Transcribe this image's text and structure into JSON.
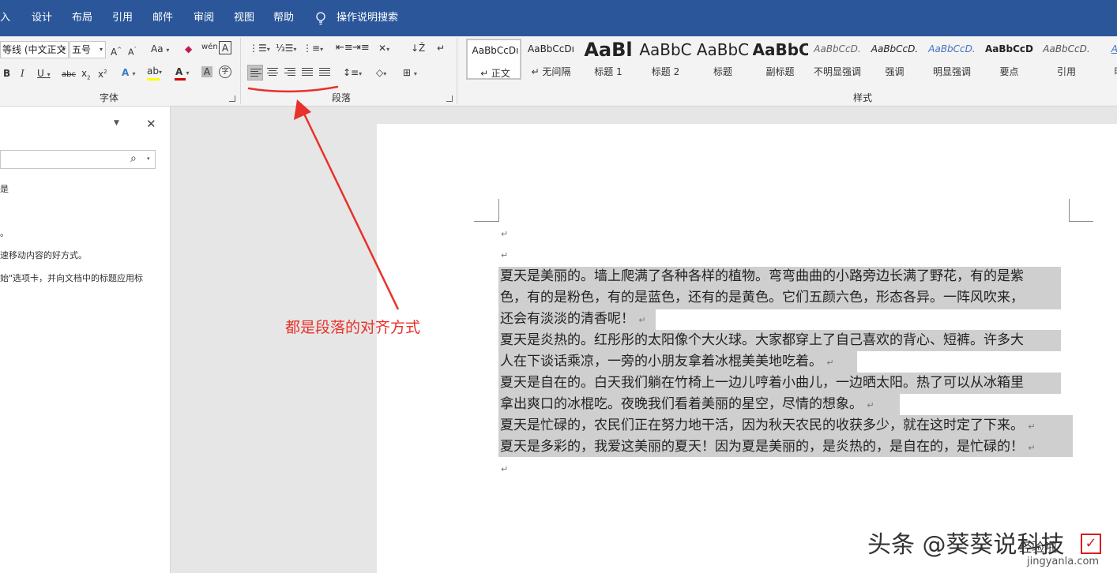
{
  "tabs": [
    "入",
    "设计",
    "布局",
    "引用",
    "邮件",
    "审阅",
    "视图",
    "帮助"
  ],
  "tell_me": "操作说明搜索",
  "font": {
    "family": "等线 (中文正文",
    "size": "五号",
    "group_label": "字体"
  },
  "paragraph": {
    "group_label": "段落"
  },
  "styles": {
    "group_label": "样式",
    "items": [
      {
        "preview": "AaBbCcDı",
        "name": "↵ 正文"
      },
      {
        "preview": "AaBbCcDı",
        "name": "↵ 无间隔"
      },
      {
        "preview": "AaBl",
        "name": "标题 1"
      },
      {
        "preview": "AaBbC",
        "name": "标题 2"
      },
      {
        "preview": "AaBbC",
        "name": "标题"
      },
      {
        "preview": "AaBbC",
        "name": "副标题"
      },
      {
        "preview": "AaBbCcD.",
        "name": "不明显强调"
      },
      {
        "preview": "AaBbCcD.",
        "name": "强调"
      },
      {
        "preview": "AaBbCcD.",
        "name": "明显强调"
      },
      {
        "preview": "AaBbCcD",
        "name": "要点"
      },
      {
        "preview": "AaBbCcD.",
        "name": "引用"
      },
      {
        "preview": "AaBb",
        "name": "明显"
      }
    ]
  },
  "navpane": {
    "lines": [
      "是",
      "。",
      "速移动内容的好方式。",
      "始\"选项卡，并向文档中的标题应用标"
    ]
  },
  "document": {
    "lines": [
      "夏天是美丽的。墙上爬满了各种各样的植物。弯弯曲曲的小路旁边长满了野花，有的是紫",
      "色，有的是粉色，有的是蓝色，还有的是黄色。它们五颜六色，形态各异。一阵风吹来，",
      "还会有淡淡的清香呢！",
      "夏天是炎热的。红彤彤的太阳像个大火球。大家都穿上了自己喜欢的背心、短裤。许多大",
      "人在下谈话乘凉，一旁的小朋友拿着冰棍美美地吃着。",
      "夏天是自在的。白天我们躺在竹椅上一边儿哼着小曲儿，一边晒太阳。热了可以从冰箱里",
      "拿出爽口的冰棍吃。夜晚我们看着美丽的星空，尽情的想象。",
      "夏天是忙碌的，农民们正在努力地干活，因为秋天农民的收获多少，就在这时定了下来。",
      "夏天是多彩的，我爱这美丽的夏天！因为夏是美丽的，是炎热的，是自在的，是忙碌的！"
    ]
  },
  "annotation": "都是段落的对齐方式",
  "watermark": {
    "main": "头条 @葵葵说科技",
    "sub": "jingyanla.com",
    "badge": "经验啦"
  },
  "colors": {
    "title_bar": "#2b579a",
    "annotation": "#e8312a",
    "selection": "#cfcfcf"
  }
}
